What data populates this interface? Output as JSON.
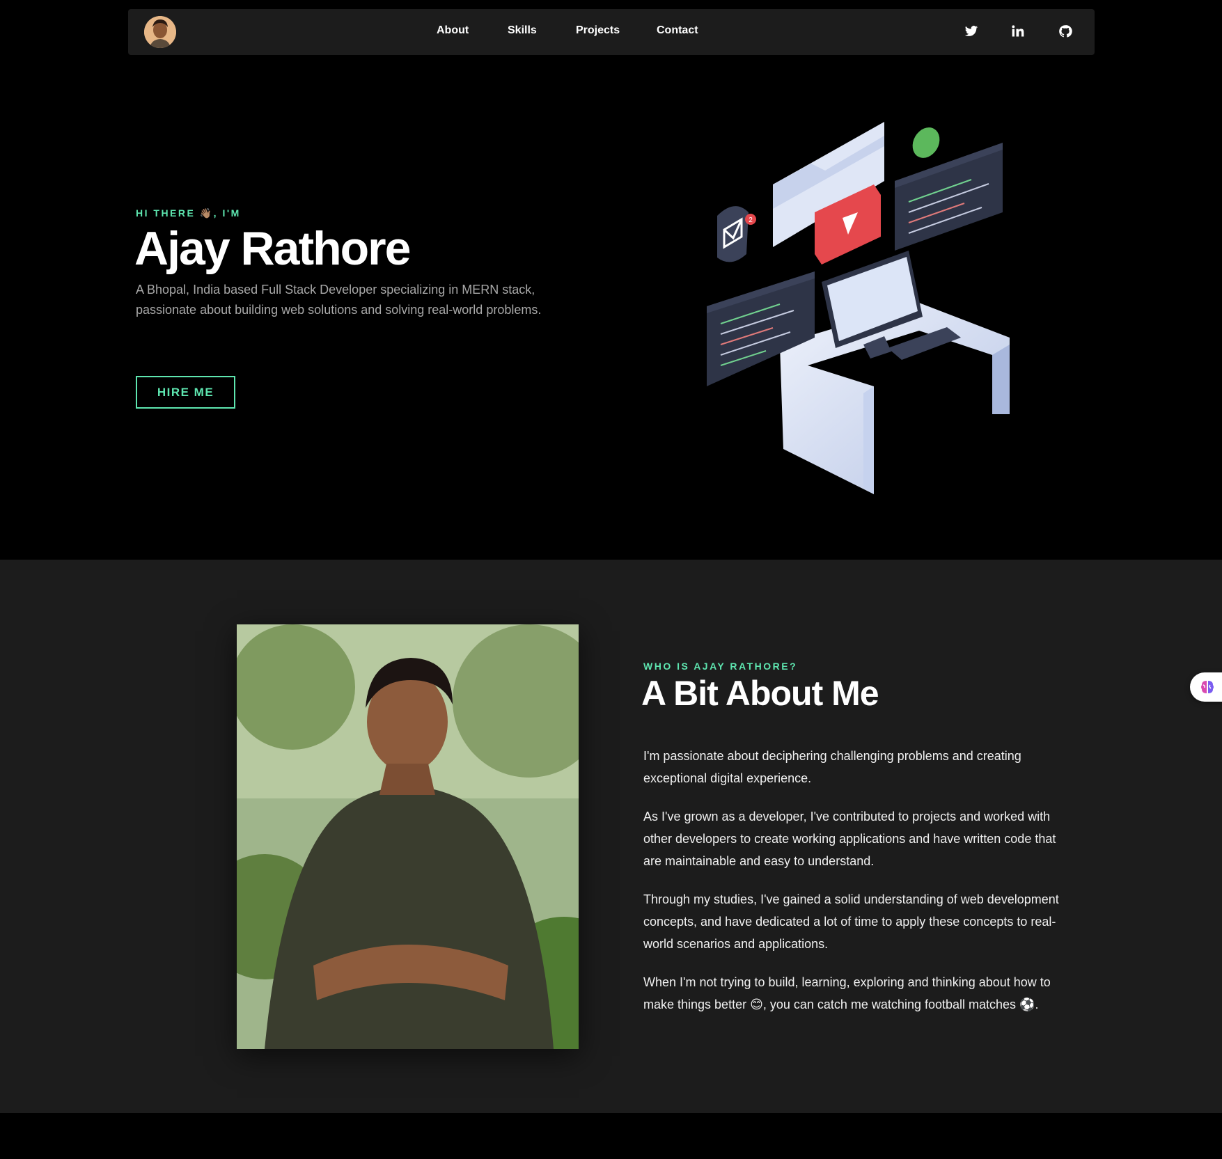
{
  "nav": {
    "links": [
      "About",
      "Skills",
      "Projects",
      "Contact"
    ],
    "social": [
      "twitter-icon",
      "linkedin-icon",
      "github-icon"
    ]
  },
  "hero": {
    "greeting": "HI THERE 👋🏽, I'M",
    "name": "Ajay Rathore",
    "description": "A Bhopal, India based Full Stack Developer specializing in MERN stack, passionate about building web solutions and solving real-world problems.",
    "cta": "HIRE ME",
    "illustration_icons": [
      "mail-icon",
      "play-icon",
      "chat-bubble-icon",
      "folder-icon"
    ],
    "mail_badge": "2"
  },
  "about": {
    "eyebrow": "WHO IS AJAY RATHORE?",
    "title": "A Bit About Me",
    "paragraphs": [
      "I'm passionate about deciphering challenging problems and creating exceptional digital experience.",
      "As I've grown as a developer, I've contributed to projects and worked with other developers to create working applications and have written code that are maintainable and easy to understand.",
      "Through my studies, I've gained a solid understanding of web development concepts, and have dedicated a lot of time to apply these concepts to real-world scenarios and applications.",
      "When I'm not trying to build, learning, exploring and thinking about how to make things better 😊, you can catch me watching football matches ⚽."
    ]
  },
  "colors": {
    "accent": "#5ee6b0",
    "page_bg": "#000000",
    "section_bg": "#1c1c1c",
    "nav_bg": "#1c1c1c"
  }
}
